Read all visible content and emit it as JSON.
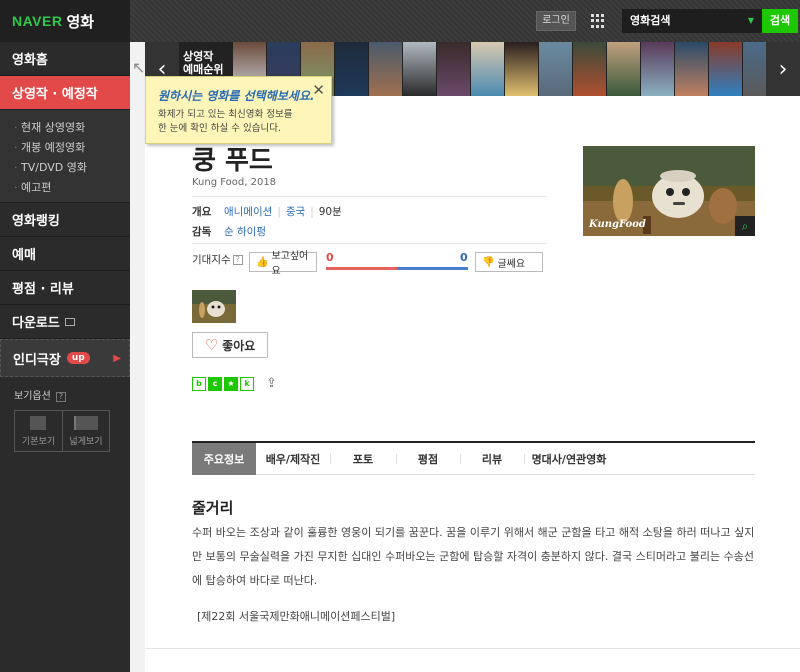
{
  "sidebar": {
    "logo_naver": "NAVER",
    "logo_movie": "영화",
    "items": [
      {
        "label": "영화홈"
      },
      {
        "label": "상영작 · 예정작"
      },
      {
        "label": "영화랭킹"
      },
      {
        "label": "예매"
      },
      {
        "label": "평점 · 리뷰"
      },
      {
        "label": "다운로드"
      }
    ],
    "subitems": [
      "현재 상영영화",
      "개봉 예정영화",
      "TV/DVD 영화",
      "예고편"
    ],
    "indie_label": "인디극장",
    "indie_badge": "up",
    "view_options_label": "보기옵션",
    "view_default": "기본보기",
    "view_wide": "넓게보기"
  },
  "topbar": {
    "login": "로그인",
    "search_scope": "영화검색",
    "search_button": "검색"
  },
  "strip": {
    "label_line1": "상영작",
    "label_line2": "예매순위",
    "poster_colors": [
      "#6b4a3a",
      "#2a3d5c",
      "#8a6a4a",
      "#1e2a3a",
      "#4a5a6a",
      "#b0b8c0",
      "#3a2a2a",
      "#d8c8b0",
      "#2a1e1e",
      "#6a8aa0",
      "#3a4a3a",
      "#c0a080",
      "#5a3a5a",
      "#2a4a6a",
      "#8a3a2a",
      "#4a6a8a",
      "#d0d8e0",
      "#3a3a5a",
      "#7a9a6a",
      "#1e3a5a",
      "#a07050",
      "#2a2a2a",
      "#6a4a6a",
      "#4a8ab0",
      "#e0c070",
      "#5a6a7a",
      "#b05030",
      "#3a5a3a",
      "#8ab0c0",
      "#c08060",
      "#3080c0",
      "#5a5a5a",
      "#70a0c0",
      "#e0a040",
      "#4070b0"
    ]
  },
  "tooltip": {
    "title": "원하시는 영화를 선택해보세요.",
    "body_line1": "화제가 되고 있는 최신영화 정보를",
    "body_line2": "한 눈에 확인 하실 수 있습니다."
  },
  "movie": {
    "title": "쿵 푸드",
    "subtitle": "Kung Food, 2018",
    "overview_label": "개요",
    "genre": "애니메이션",
    "country": "중국",
    "runtime": "90분",
    "director_label": "감독",
    "director": "순 하이펑",
    "expect_label": "기대지수",
    "want_label": "보고싶어요",
    "nope_label": "글쎄요",
    "want_score": "0",
    "nope_score": "0",
    "poster_brand": "KungFood",
    "like_label": "좋아요"
  },
  "tabs": [
    {
      "label": "주요정보",
      "width": 64
    },
    {
      "label": "배우/제작진",
      "width": 74
    },
    {
      "label": "포토",
      "width": 66
    },
    {
      "label": "평점",
      "width": 64
    },
    {
      "label": "리뷰",
      "width": 64
    },
    {
      "label": "명대사/연관영화",
      "width": 90
    }
  ],
  "story": {
    "heading": "줄거리",
    "body": "수퍼 바오는 조상과 같이 훌륭한 영웅이 되기를 꿈꾼다. 꿈을 이루기 위해서 해군 군함을 타고 해적 소탕을 하러 떠나고 싶지만 보통의 무술실력을 가진 무지한 십대인 수퍼바오는 군함에 탑승할 자격이 충분하지 않다. 결국 스티머라고 불리는 수송선에 탑승하여 바다로 떠난다.",
    "festival": "[제22회 서울국제만화애니메이션페스티벌]"
  }
}
